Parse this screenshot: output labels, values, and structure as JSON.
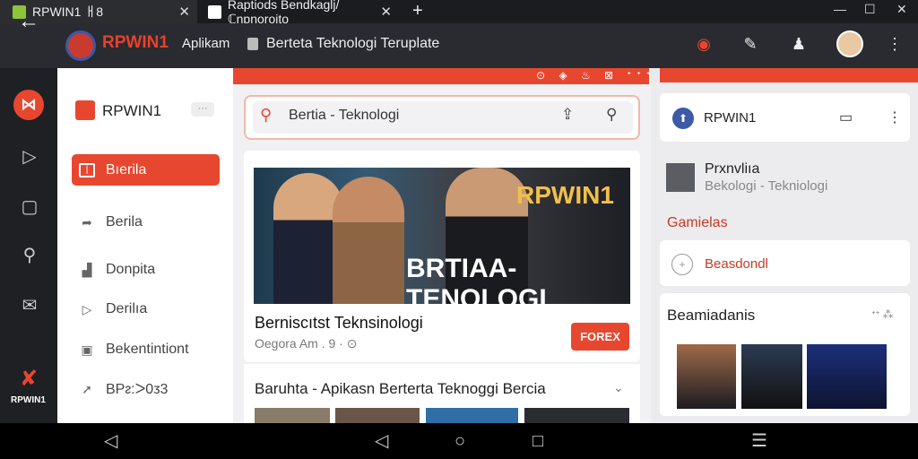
{
  "tabs": [
    {
      "label": "RPWIN1 ㅐ8",
      "active": true
    },
    {
      "label": "Raptiods Bendkaglj/ℂnpnoroito",
      "active": false
    }
  ],
  "window": {
    "minimize": "—",
    "maximize": "☐",
    "close": "✕",
    "new_tab": "+"
  },
  "address_bar": {
    "brand": "RPWIN1",
    "brand_sub": "Aplikam",
    "url": "Berteta Teknologi Teruplate"
  },
  "rail": {
    "logo_text": "RPWIN1"
  },
  "sidebar": {
    "brand": "RPWIN1",
    "items": [
      {
        "label": "Bıerila",
        "icon": "news-icon",
        "active": true
      },
      {
        "label": "Berila",
        "icon": "share-icon"
      },
      {
        "label": "Donpita",
        "icon": "chart-icon"
      },
      {
        "label": "Derilıa",
        "icon": "video-icon"
      },
      {
        "label": "Bekentintiont",
        "icon": "image-icon"
      },
      {
        "label": "BPᴤ:ᐳ0ᴣ3",
        "icon": "send-icon"
      }
    ]
  },
  "topbar": {
    "icons": "⊙ ◈ ♨ ⊠ ᐩᐩᐩ"
  },
  "search": {
    "value": "Bertia - Teknologi"
  },
  "news": {
    "hero_line1": "RPWIN1",
    "hero_line2": "BRTIAA-TENOLOGI",
    "title": "Berniscıtst Teknsinologi",
    "meta": "Oegora Am . 9 · ⊙",
    "cta": "FOREX"
  },
  "list": {
    "title": "Baruhta - Apikasn Berterta Teknoɡgi Bercia"
  },
  "right": {
    "profile_name": "RPWIN1",
    "channel_name": "Prxnvliıa",
    "channel_sub": "Bekologi - Tekniologi",
    "section_label": "Gamielas",
    "card_label": "Beasdondl",
    "videos_title": "Beamiadanis",
    "videos_count": "ᐩᐩ ⁂"
  },
  "colors": {
    "accent": "#e8472f",
    "dark": "#1f2024",
    "brand_blue": "#3c5aa6"
  }
}
